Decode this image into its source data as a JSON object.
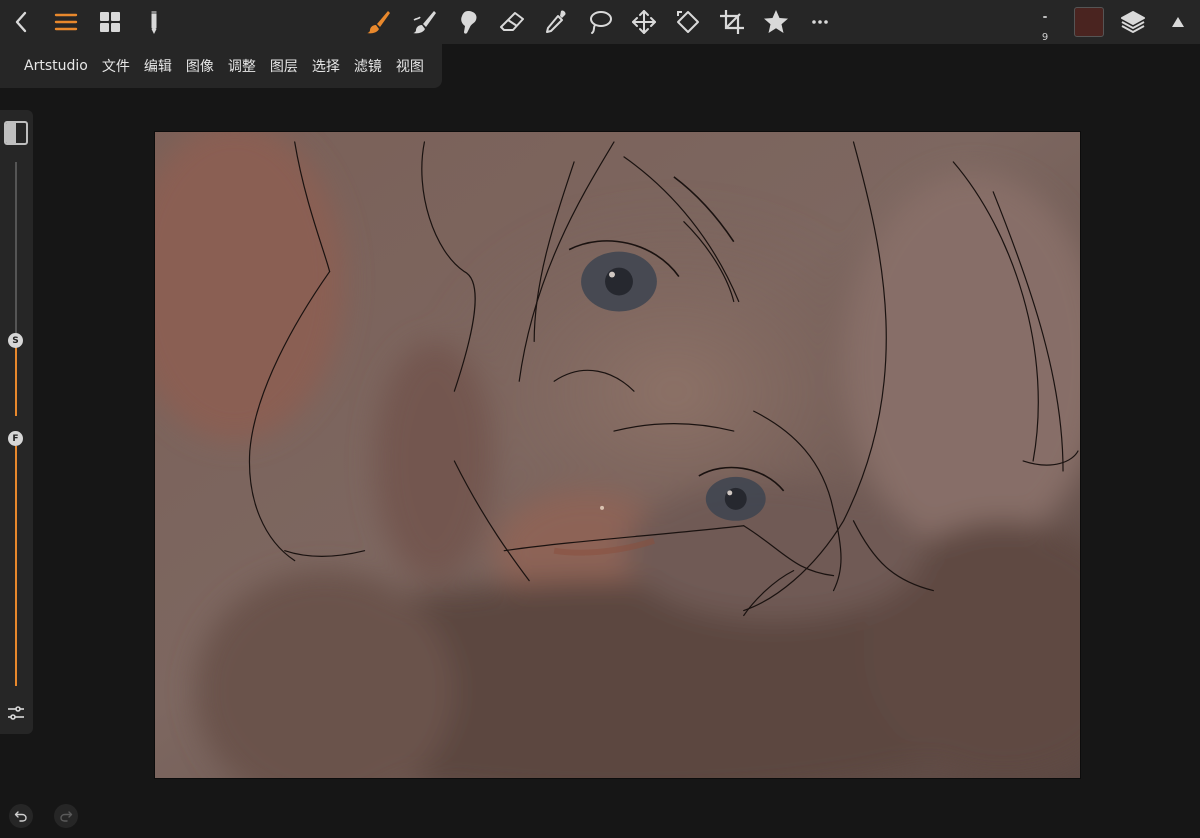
{
  "toolbar": {
    "left_tools": [
      "back-icon",
      "menu-icon",
      "gallery-icon",
      "pencil-icon"
    ],
    "center_tools": [
      "brush-icon",
      "smudge-icon",
      "clone-stamp-icon",
      "eraser-icon",
      "eyedropper-icon",
      "lasso-icon",
      "move-icon",
      "transform-icon",
      "crop-icon",
      "favorites-star-icon",
      "more-icon"
    ],
    "active_tool": "brush-icon",
    "brush_size": "9",
    "current_color": "#4a2420",
    "accent_color": "#e8882c"
  },
  "menu": {
    "items": [
      "Artstudio",
      "文件",
      "编辑",
      "图像",
      "调整",
      "图层",
      "选择",
      "滤镜",
      "视图"
    ]
  },
  "side_panel": {
    "size_slider_label": "S",
    "flow_slider_label": "F",
    "size_value_fraction": 0.39,
    "flow_value_fraction": 0.47
  },
  "canvas": {
    "artwork": "painted-portrait-sketch"
  }
}
